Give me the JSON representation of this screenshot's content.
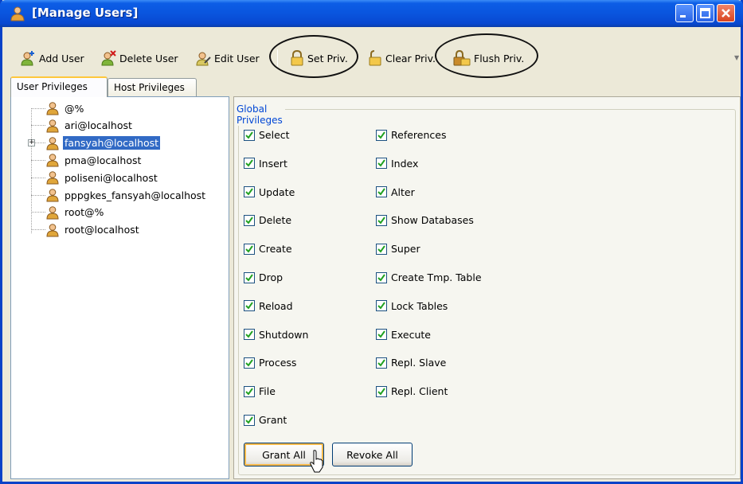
{
  "window": {
    "title": "[Manage Users]"
  },
  "toolbar": {
    "add_user": "Add User",
    "delete_user": "Delete User",
    "edit_user": "Edit User",
    "set_priv": "Set Priv.",
    "clear_priv": "Clear Priv.",
    "flush_priv": "Flush Priv."
  },
  "tabs": [
    "User Privileges",
    "Host Privileges"
  ],
  "users": [
    {
      "label": "@%"
    },
    {
      "label": "ari@localhost"
    },
    {
      "label": "fansyah@localhost",
      "selected": true,
      "expandable": true
    },
    {
      "label": "pma@localhost"
    },
    {
      "label": "poliseni@localhost"
    },
    {
      "label": "pppgkes_fansyah@localhost"
    },
    {
      "label": "root@%"
    },
    {
      "label": "root@localhost"
    }
  ],
  "privileges": {
    "group_title": "Global Privileges",
    "col1": [
      {
        "label": "Select",
        "checked": true
      },
      {
        "label": "Insert",
        "checked": true
      },
      {
        "label": "Update",
        "checked": true
      },
      {
        "label": "Delete",
        "checked": true
      },
      {
        "label": "Create",
        "checked": true
      },
      {
        "label": "Drop",
        "checked": true
      },
      {
        "label": "Reload",
        "checked": true
      },
      {
        "label": "Shutdown",
        "checked": true
      },
      {
        "label": "Process",
        "checked": true
      },
      {
        "label": "File",
        "checked": true
      },
      {
        "label": "Grant",
        "checked": true
      }
    ],
    "col2": [
      {
        "label": "References",
        "checked": true
      },
      {
        "label": "Index",
        "checked": true
      },
      {
        "label": "Alter",
        "checked": true
      },
      {
        "label": "Show Databases",
        "checked": true
      },
      {
        "label": "Super",
        "checked": true
      },
      {
        "label": "Create Tmp. Table",
        "checked": true
      },
      {
        "label": "Lock Tables",
        "checked": true
      },
      {
        "label": "Execute",
        "checked": true
      },
      {
        "label": "Repl. Slave",
        "checked": true
      },
      {
        "label": "Repl. Client",
        "checked": true
      }
    ],
    "grant_all": "Grant All",
    "revoke_all": "Revoke All"
  },
  "colors": {
    "titlebar": "#0a55de",
    "selection": "#316ac5",
    "group_title": "#0046d5",
    "check": "#21a121"
  }
}
